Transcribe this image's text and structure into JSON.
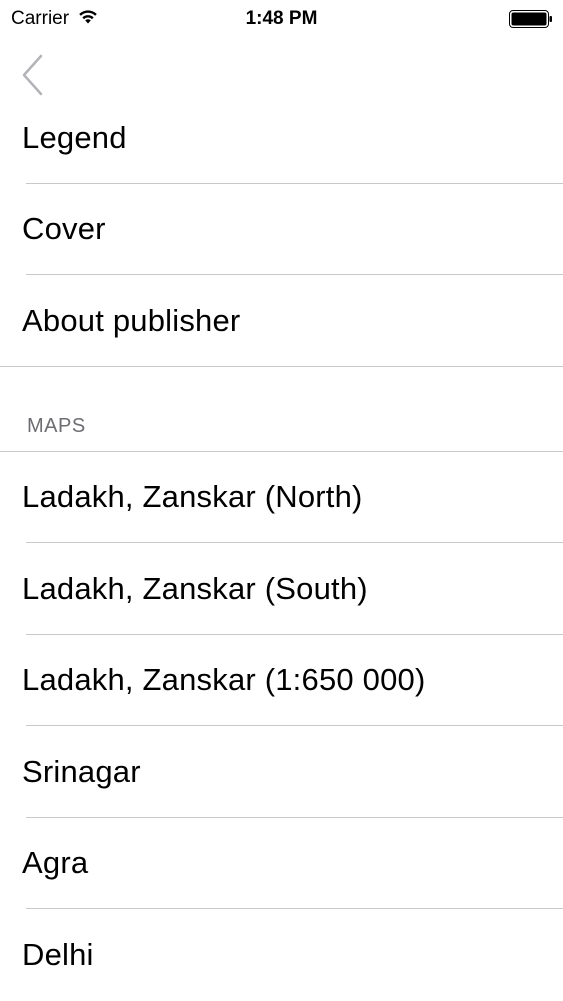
{
  "status_bar": {
    "carrier": "Carrier",
    "time": "1:48 PM",
    "wifi_icon": "wifi-icon",
    "battery_icon": "battery-full-icon"
  },
  "nav": {
    "back_icon": "chevron-left-icon"
  },
  "top_items": [
    {
      "label": "Legend"
    },
    {
      "label": "Cover"
    },
    {
      "label": "About publisher"
    }
  ],
  "maps_section": {
    "header": "MAPS",
    "items": [
      {
        "label": "Ladakh, Zanskar (North)"
      },
      {
        "label": "Ladakh, Zanskar (South)"
      },
      {
        "label": "Ladakh, Zanskar (1:650 000)"
      },
      {
        "label": "Srinagar"
      },
      {
        "label": "Agra"
      },
      {
        "label": "Delhi"
      }
    ]
  },
  "colors": {
    "separator": "#c8c7cc",
    "section_header_text": "#6d6d72",
    "back_chevron": "#b4b4b8",
    "text": "#000000"
  }
}
